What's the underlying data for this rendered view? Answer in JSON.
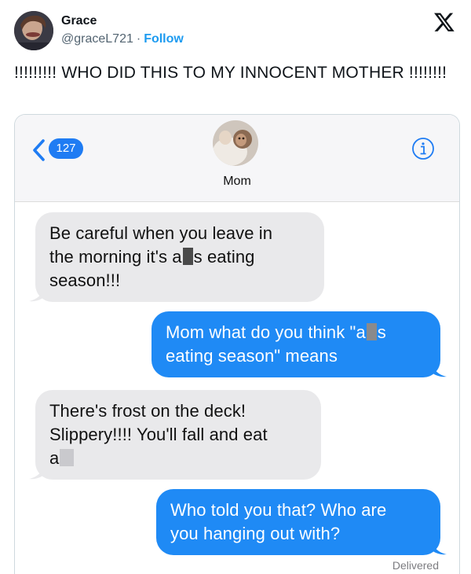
{
  "tweet": {
    "user_name": "Grace",
    "handle": "@graceL721",
    "separator": "·",
    "follow_label": "Follow",
    "text": "!!!!!!!!! WHO DID THIS TO MY INNOCENT MOTHER !!!!!!!!"
  },
  "messages_app": {
    "back_badge": "127",
    "contact_name": "Mom",
    "icons": {
      "back": "chevron-left-icon",
      "info": "info-icon",
      "contact_photo": "contact-photo"
    },
    "accent_color": "#1f8af5",
    "incoming_color": "#e9e9eb",
    "conversation": [
      {
        "direction": "incoming",
        "lines": [
          [
            "Be careful when you leave in"
          ],
          [
            "the morning it's a",
            "[censor]",
            "s eating"
          ],
          [
            "season!!!"
          ]
        ]
      },
      {
        "direction": "outgoing",
        "lines": [
          [
            "Mom what do you think \"a",
            "[censor]",
            "s"
          ],
          [
            "eating season\" means"
          ]
        ]
      },
      {
        "direction": "incoming",
        "lines": [
          [
            "There's frost on the deck!"
          ],
          [
            "Slippery!!!! You'll fall and eat"
          ],
          [
            "a",
            "[censor]"
          ]
        ]
      },
      {
        "direction": "outgoing",
        "lines": [
          [
            "Who told you that? Who are"
          ],
          [
            "you hanging out with?"
          ]
        ]
      }
    ],
    "status": "Delivered"
  }
}
